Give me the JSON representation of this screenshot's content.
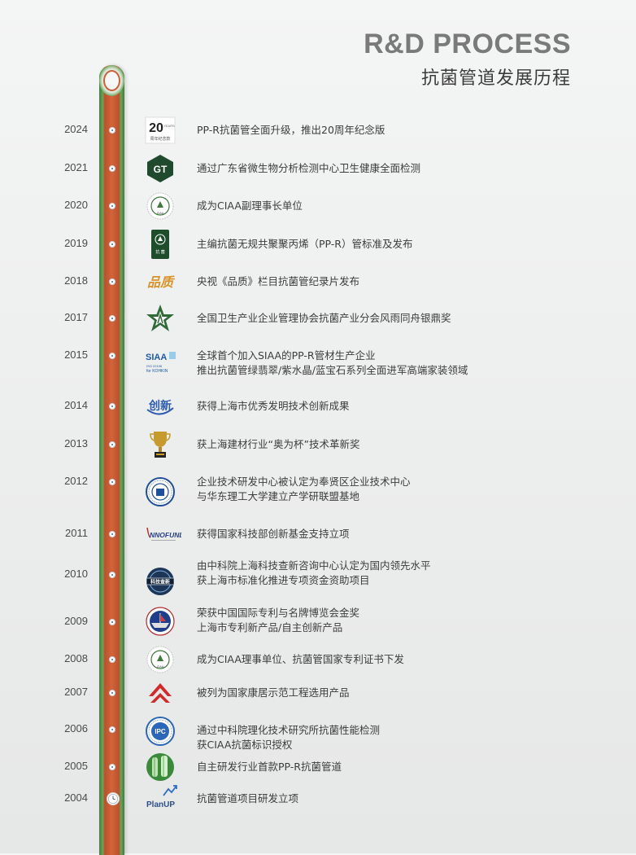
{
  "header": {
    "title_en": "R&D PROCESS",
    "title_cn": "抗菌管道发展历程"
  },
  "logos": {
    "y2024_num": "20",
    "y2024_sub": "周年纪念款",
    "y2024_years": "YEARS",
    "y2021_text": "GT",
    "y2020_text": "CIAA",
    "y2019_text": "抗 菌",
    "y2018_text": "品质",
    "y2015_siaa": "SIAA",
    "y2015_iso": "ISO 22196",
    "y2015_for": "for KOHKIN",
    "y2014_text": "创新",
    "y2011_text": "NNOFUND",
    "y2010_text": "科技查新",
    "y2008_text": "CIAA",
    "y2006_text": "IPC",
    "y2004_text": "PlanUP"
  },
  "timeline": [
    {
      "year": "2024",
      "lines": [
        "PP-R抗菌管全面升级，推出20周年纪念版"
      ]
    },
    {
      "year": "2021",
      "lines": [
        "通过广东省微生物分析检测中心卫生健康全面检测"
      ]
    },
    {
      "year": "2020",
      "lines": [
        "成为CIAA副理事长单位"
      ]
    },
    {
      "year": "2019",
      "lines": [
        "主编抗菌无规共聚聚丙烯（PP-R）管标准及发布"
      ]
    },
    {
      "year": "2018",
      "lines": [
        "央视《品质》栏目抗菌管纪录片发布"
      ]
    },
    {
      "year": "2017",
      "lines": [
        "全国卫生产业企业管理协会抗菌产业分会风雨同舟银鼎奖"
      ]
    },
    {
      "year": "2015",
      "lines": [
        "全球首个加入SIAA的PP-R管材生产企业",
        "推出抗菌管绿翡翠/紫水晶/蓝宝石系列全面进军高端家装领域"
      ]
    },
    {
      "year": "2014",
      "lines": [
        "获得上海市优秀发明技术创新成果"
      ]
    },
    {
      "year": "2013",
      "lines": [
        "获上海建材行业“奥为杯”技术革新奖"
      ]
    },
    {
      "year": "2012",
      "lines": [
        "企业技术研发中心被认定为奉贤区企业技术中心",
        "与华东理工大学建立产学研联盟基地"
      ]
    },
    {
      "year": "2011",
      "lines": [
        "获得国家科技部创新基金支持立项"
      ]
    },
    {
      "year": "2010",
      "lines": [
        "由中科院上海科技查新咨询中心认定为国内领先水平",
        "获上海市标准化推进专项资金资助项目"
      ]
    },
    {
      "year": "2009",
      "lines": [
        "荣获中国国际专利与名牌博览会金奖",
        "上海市专利新产品/自主创新产品"
      ]
    },
    {
      "year": "2008",
      "lines": [
        "成为CIAA理事单位、抗菌管国家专利证书下发"
      ]
    },
    {
      "year": "2007",
      "lines": [
        "被列为国家康居示范工程选用产品"
      ]
    },
    {
      "year": "2006",
      "lines": [
        "通过中科院理化技术研究所抗菌性能检测",
        "获CIAA抗菌标识授权"
      ]
    },
    {
      "year": "2005",
      "lines": [
        "自主研发行业首款PP-R抗菌管道"
      ]
    },
    {
      "year": "2004",
      "lines": [
        "抗菌管道项目研发立项"
      ]
    }
  ],
  "colors": {
    "pipe_green": "#3f7e3b",
    "pipe_orange": "#d2643a",
    "title_gray": "#7a7a7a"
  }
}
